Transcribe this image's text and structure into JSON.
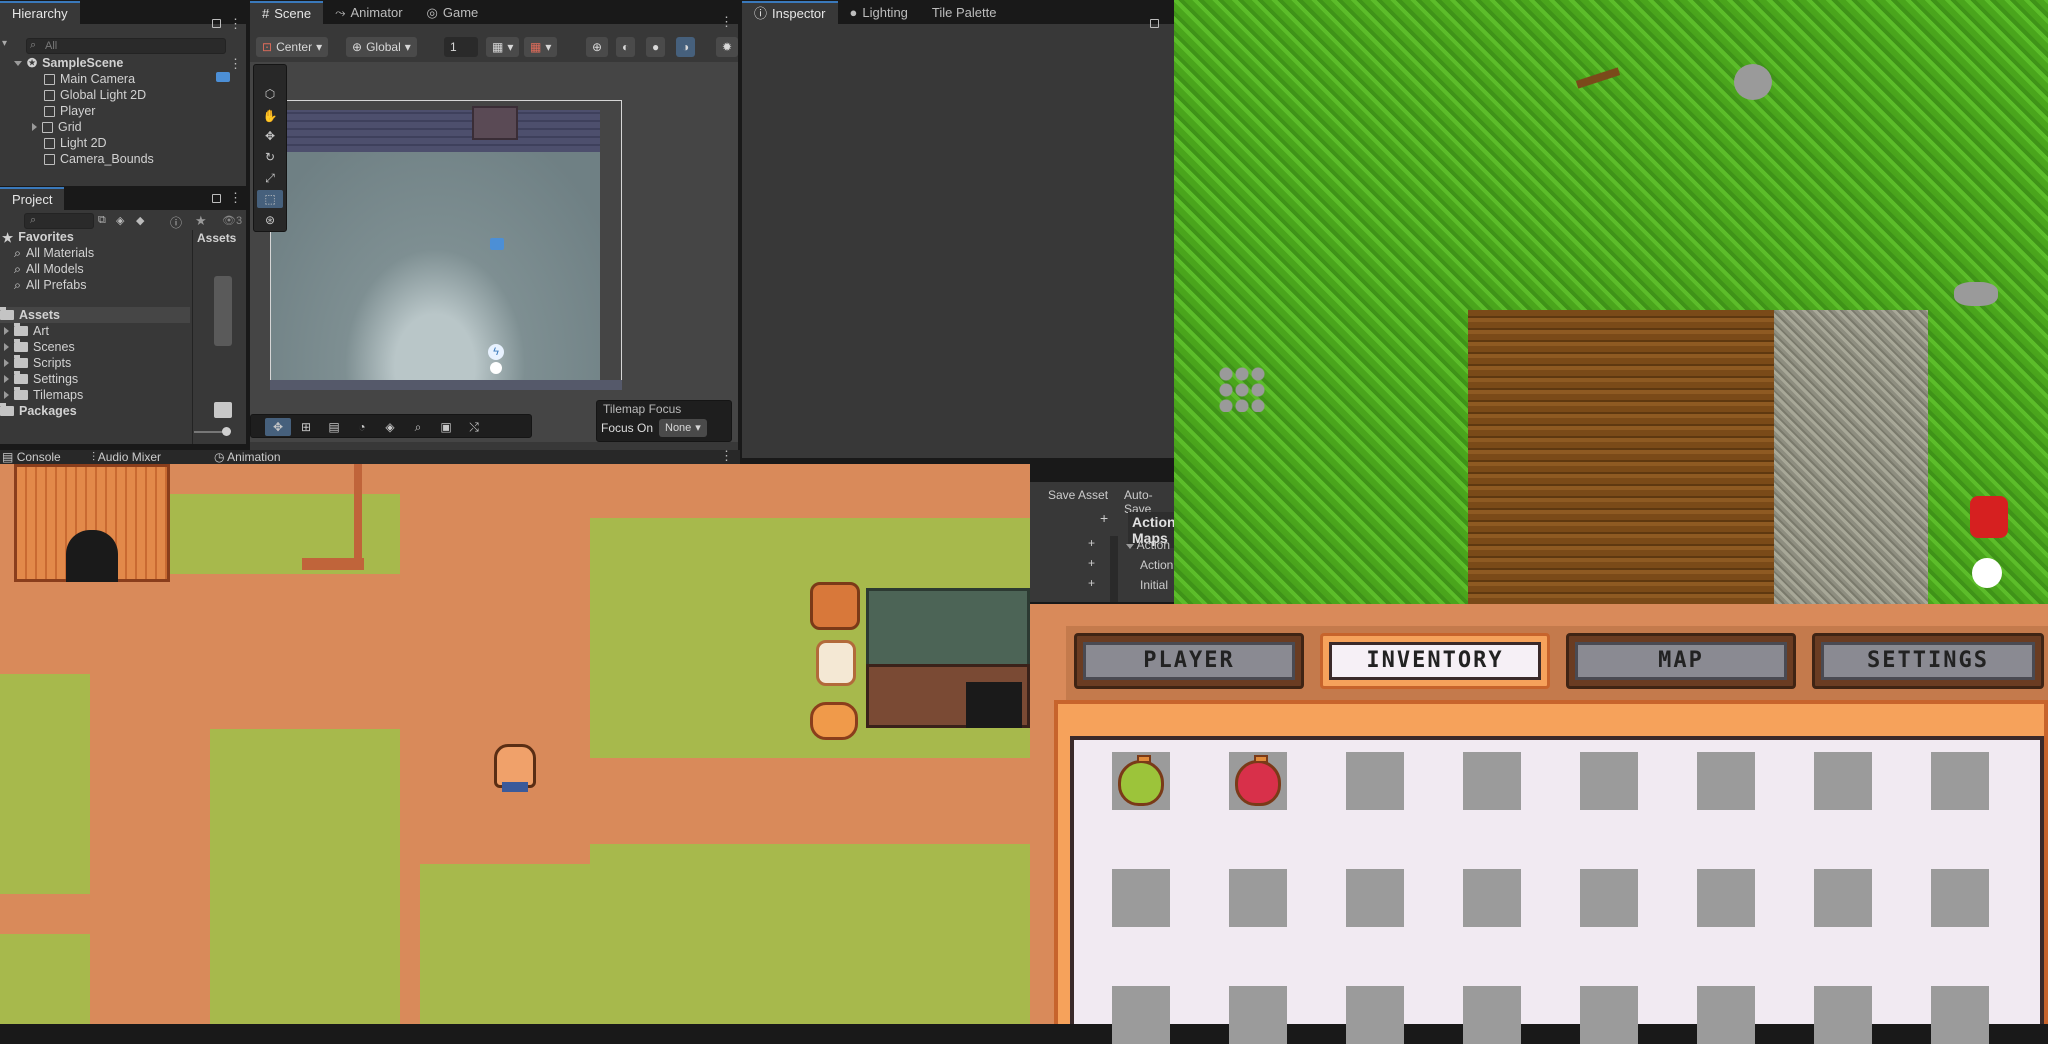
{
  "hierarchy": {
    "tab_label": "Hierarchy",
    "search_placeholder": "All",
    "scene_name": "SampleScene",
    "items": [
      {
        "label": "Main Camera"
      },
      {
        "label": "Global Light 2D"
      },
      {
        "label": "Player"
      },
      {
        "label": "Grid"
      },
      {
        "label": "Light 2D"
      },
      {
        "label": "Camera_Bounds"
      }
    ]
  },
  "scene_view": {
    "tabs": [
      "Scene",
      "Animator",
      "Game"
    ],
    "pivot_mode": "Center",
    "pivot_rotation": "Global",
    "snap_value": "1",
    "tilemap_focus": {
      "title": "Tilemap Focus",
      "label": "Focus On",
      "value": "None"
    }
  },
  "inspector": {
    "tabs": [
      "Inspector",
      "Lighting",
      "Tile Palette"
    ]
  },
  "project": {
    "tab_label": "Project",
    "hidden_count": "3",
    "favorites_label": "Favorites",
    "favorites": [
      "All Materials",
      "All Models",
      "All Prefabs"
    ],
    "assets_label": "Assets",
    "asset_folders": [
      "Art",
      "Scenes",
      "Scripts",
      "Settings",
      "Tilemaps"
    ],
    "packages_label": "Packages",
    "breadcrumb": "Assets"
  },
  "bottom_tabs": [
    "Console",
    "Audio Mixer",
    "Animation"
  ],
  "input_actions": {
    "save_asset": "Save Asset",
    "auto_save": "Auto-Save",
    "maps_header": "Action Maps",
    "rows": [
      "Action",
      "Action",
      "Initial"
    ]
  },
  "game_menu": {
    "tabs": [
      "PLAYER",
      "INVENTORY",
      "MAP",
      "SETTINGS"
    ],
    "active_tab": "INVENTORY",
    "slots": [
      {
        "item": "green-potion"
      },
      {
        "item": "red-potion"
      },
      {
        "item": ""
      },
      {
        "item": ""
      },
      {
        "item": ""
      },
      {
        "item": ""
      },
      {
        "item": ""
      },
      {
        "item": ""
      },
      {
        "item": ""
      },
      {
        "item": ""
      },
      {
        "item": ""
      },
      {
        "item": ""
      },
      {
        "item": ""
      },
      {
        "item": ""
      },
      {
        "item": ""
      },
      {
        "item": ""
      },
      {
        "item": ""
      },
      {
        "item": ""
      },
      {
        "item": ""
      },
      {
        "item": ""
      },
      {
        "item": ""
      },
      {
        "item": ""
      },
      {
        "item": ""
      },
      {
        "item": ""
      }
    ]
  },
  "colors": {
    "editor_bg": "#383838",
    "accent_blue": "#3a79bb",
    "grass": "#4aa51c",
    "dirt": "#d98a5a",
    "menu_orange": "#f6a25b"
  }
}
